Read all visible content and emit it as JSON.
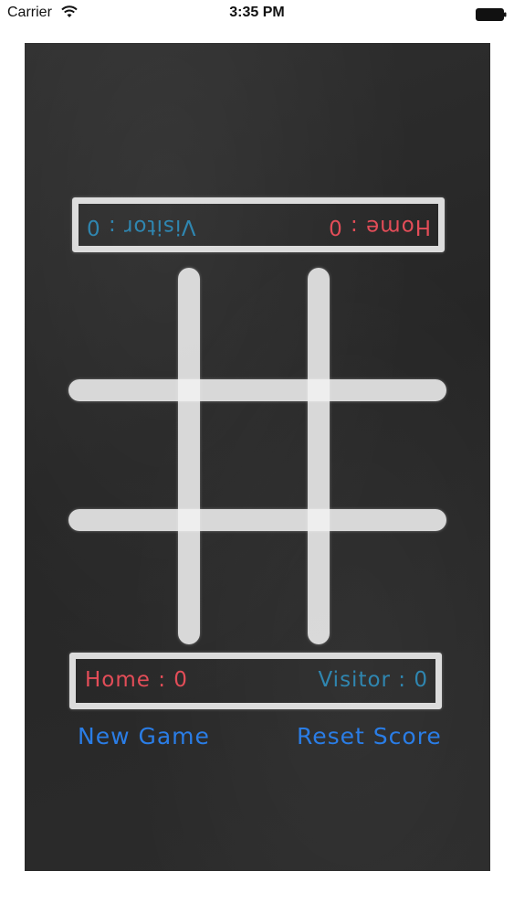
{
  "status_bar": {
    "carrier": "Carrier",
    "time": "3:35 PM",
    "wifi_icon": "wifi-icon",
    "battery_icon": "battery-icon"
  },
  "colors": {
    "chalkboard": "#2b2b2b",
    "chalk": "#f0f0f0",
    "home": "#e34d58",
    "visitor": "#2f86b0",
    "button": "#2a7de6"
  },
  "top_score_panel": {
    "home_label": "Home : 0",
    "visitor_label": "Visitor : 0"
  },
  "bottom_score_panel": {
    "home_label": "Home : 0",
    "visitor_label": "Visitor : 0"
  },
  "actions": {
    "new_game": "New Game",
    "reset_score": "Reset Score"
  }
}
